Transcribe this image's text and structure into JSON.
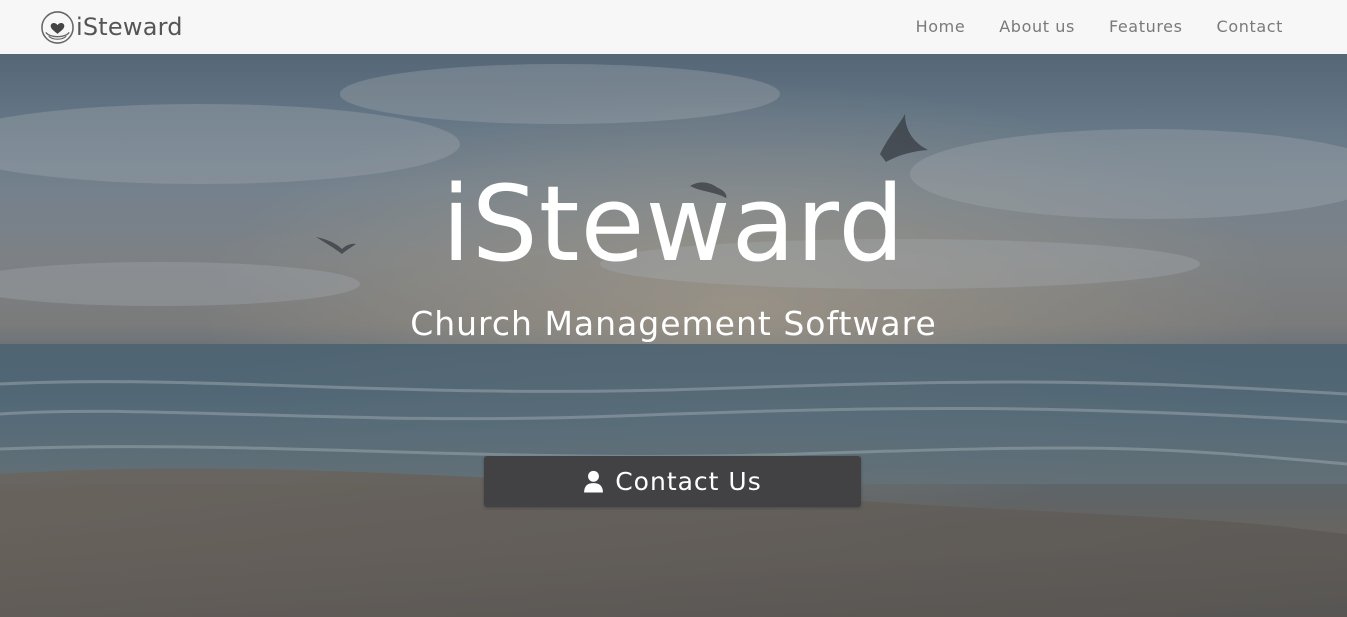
{
  "brand": {
    "name": "iSteward",
    "logo_icon": "heart-in-hands-icon"
  },
  "nav": {
    "items": [
      {
        "label": "Home"
      },
      {
        "label": "About us"
      },
      {
        "label": "Features"
      },
      {
        "label": "Contact"
      }
    ]
  },
  "hero": {
    "title": "iSteward",
    "subtitle": "Church Management Software",
    "background": "seaside-sunset-with-gulls",
    "cta": {
      "label": "Contact Us",
      "icon": "user-icon"
    }
  },
  "colors": {
    "navbar_bg": "#f7f7f7",
    "nav_text": "#7a7a7a",
    "button_bg": "#424245",
    "hero_text": "#ffffff"
  }
}
